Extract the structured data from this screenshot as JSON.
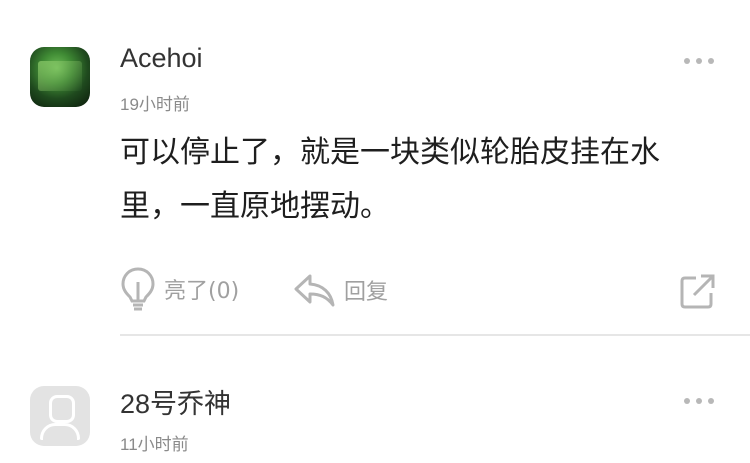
{
  "comments": [
    {
      "username": "Acehoi",
      "time": "19小时前",
      "text": "可以停止了，就是一块类似轮胎皮挂在水里，一直原地摆动。",
      "avatar_icon": "photo-avatar",
      "actions": {
        "like_label": "亮了(0)",
        "reply_label": "回复"
      }
    },
    {
      "username": "28号乔神",
      "time": "11小时前",
      "avatar_icon": "default-user-avatar"
    }
  ],
  "colors": {
    "muted": "#a0a0a0",
    "divider": "#e6e6e6"
  }
}
